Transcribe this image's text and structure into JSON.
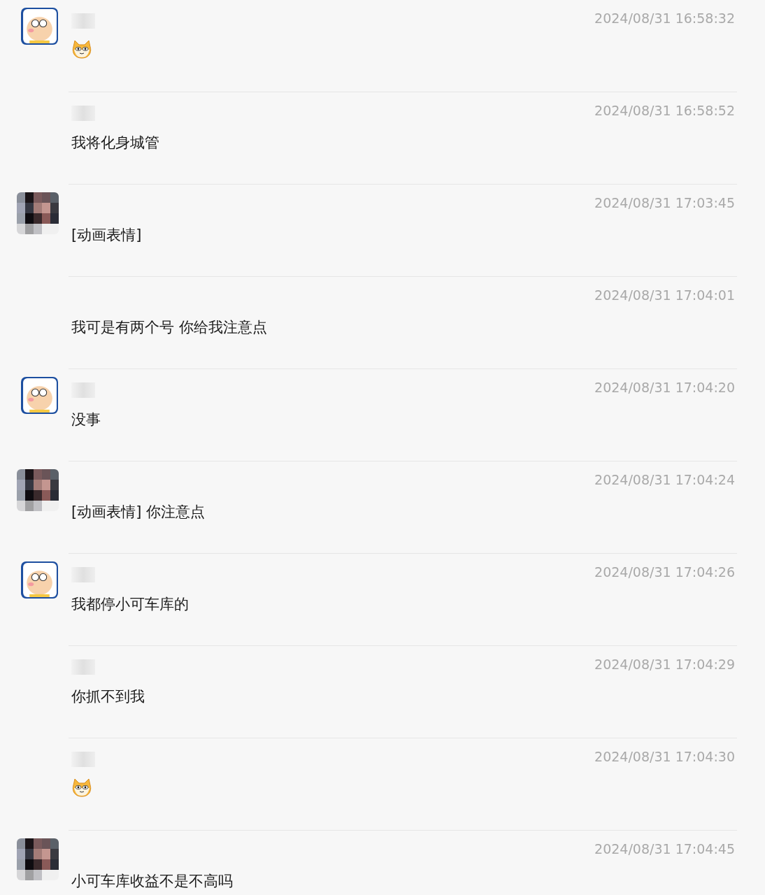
{
  "messages": [
    {
      "avatar": {
        "kind": "cartoon"
      },
      "name_redacted": true,
      "time": "2024/08/31 16:58:32",
      "kind": "sticker"
    },
    {
      "name_redacted": true,
      "time": "2024/08/31 16:58:52",
      "kind": "text",
      "text": "我将化身城管"
    },
    {
      "avatar": {
        "kind": "mosaic"
      },
      "name_redacted": false,
      "time": "2024/08/31 17:03:45",
      "kind": "text",
      "text": "[动画表情]"
    },
    {
      "name_redacted": false,
      "time": "2024/08/31 17:04:01",
      "kind": "text",
      "text": "我可是有两个号 你给我注意点"
    },
    {
      "avatar": {
        "kind": "cartoon"
      },
      "name_redacted": true,
      "time": "2024/08/31 17:04:20",
      "kind": "text",
      "text": "没事"
    },
    {
      "avatar": {
        "kind": "mosaic"
      },
      "name_redacted": false,
      "time": "2024/08/31 17:04:24",
      "kind": "text",
      "text": "[动画表情] 你注意点"
    },
    {
      "avatar": {
        "kind": "cartoon"
      },
      "name_redacted": true,
      "time": "2024/08/31 17:04:26",
      "kind": "text",
      "text": "我都停小可车库的"
    },
    {
      "name_redacted": true,
      "time": "2024/08/31 17:04:29",
      "kind": "text",
      "text": "你抓不到我"
    },
    {
      "name_redacted": true,
      "time": "2024/08/31 17:04:30",
      "kind": "sticker"
    },
    {
      "avatar": {
        "kind": "mosaic"
      },
      "name_redacted": false,
      "time": "2024/08/31 17:04:45",
      "kind": "text",
      "text": "小可车库收益不是不高吗"
    }
  ]
}
